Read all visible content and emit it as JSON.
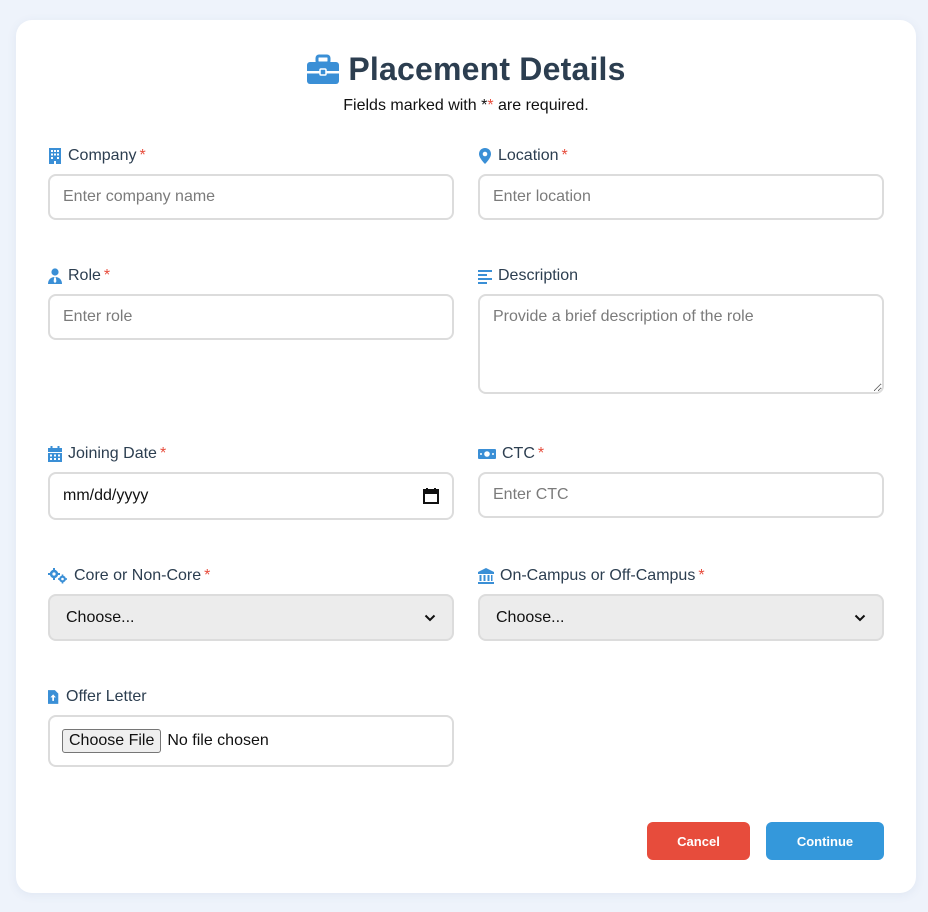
{
  "header": {
    "title": "Placement Details",
    "subtitle_before": "Fields marked with ",
    "subtitle_star_black": "*",
    "subtitle_star_red": "*",
    "subtitle_after": " are required."
  },
  "fields": {
    "company": {
      "label": "Company",
      "required_mark": "*",
      "placeholder": "Enter company name",
      "icon": "building-icon"
    },
    "location": {
      "label": "Location",
      "required_mark": "*",
      "placeholder": "Enter location",
      "icon": "map-pin-icon"
    },
    "role": {
      "label": "Role",
      "required_mark": "*",
      "placeholder": "Enter role",
      "icon": "user-tie-icon"
    },
    "description": {
      "label": "Description",
      "placeholder": "Provide a brief description of the role",
      "icon": "align-left-icon"
    },
    "joining_date": {
      "label": "Joining Date",
      "required_mark": "*",
      "value": "mm/dd/yyyy",
      "icon": "calendar-icon"
    },
    "ctc": {
      "label": "CTC",
      "required_mark": "*",
      "placeholder": "Enter CTC",
      "icon": "money-bill-icon"
    },
    "core": {
      "label": "Core or Non-Core",
      "required_mark": "*",
      "selected": "Choose...",
      "icon": "gears-icon"
    },
    "campus": {
      "label": "On-Campus or Off-Campus",
      "required_mark": "*",
      "selected": "Choose...",
      "icon": "institution-icon"
    },
    "offer_letter": {
      "label": "Offer Letter",
      "button_label": "Choose File",
      "status": "No file chosen",
      "icon": "file-upload-icon"
    }
  },
  "actions": {
    "cancel_label": "Cancel",
    "continue_label": "Continue"
  },
  "colors": {
    "accent": "#3498db",
    "icon": "#3a8fd6",
    "danger": "#e74c3c",
    "heading": "#2c3e50",
    "background": "#eef3fb"
  }
}
